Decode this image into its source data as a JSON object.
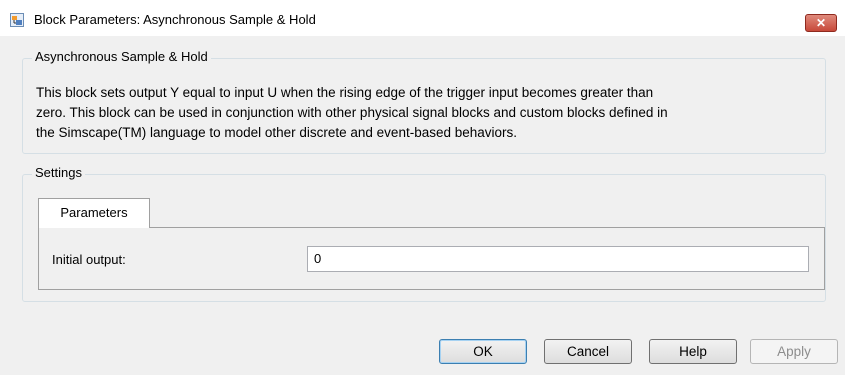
{
  "window": {
    "title": "Block Parameters: Asynchronous Sample & Hold",
    "close_label": "✕"
  },
  "description_group": {
    "title": "Asynchronous Sample & Hold",
    "lines": [
      "This block sets output Y equal to input U when the rising edge of the trigger input becomes greater than",
      "zero. This block can be used in conjunction with other physical signal blocks and custom blocks defined in",
      "the Simscape(TM) language to model other discrete and event-based behaviors."
    ]
  },
  "settings_group": {
    "title": "Settings",
    "tabs": [
      {
        "label": "Parameters",
        "selected": true
      }
    ],
    "fields": [
      {
        "label": "Initial output:",
        "value": "0"
      }
    ]
  },
  "buttons": {
    "ok": "OK",
    "cancel": "Cancel",
    "help": "Help",
    "apply": "Apply"
  }
}
